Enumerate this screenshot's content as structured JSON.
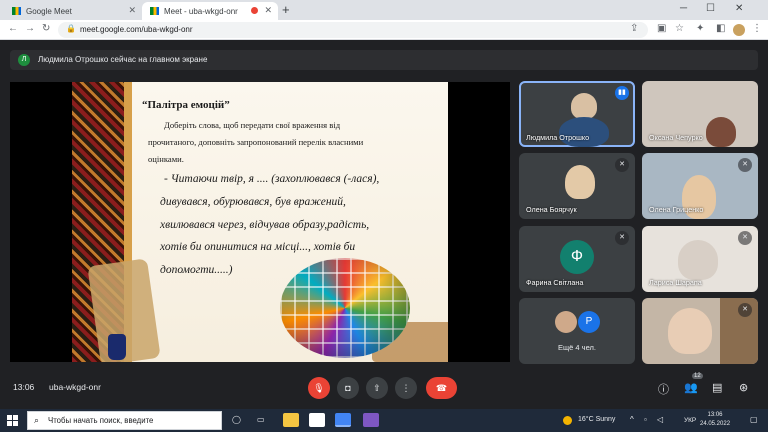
{
  "browser": {
    "tabs": [
      {
        "title": "Google Meet",
        "active": false
      },
      {
        "title": "Meet - uba-wkgd-onr",
        "active": true
      }
    ],
    "url": "meet.google.com/uba-wkgd-onr"
  },
  "meet": {
    "presenting_text": "Людмила Отрошко сейчас на главном экране",
    "presenter_initial": "Л",
    "slide": {
      "title": "“Палітра емоцій”",
      "lines_small": [
        "Доберіть слова, щоб передати свої враження від",
        "прочитаного, доповніть запропонований перелік власними",
        "оцінками."
      ],
      "lines_big": [
        "- Читаючи твір, я ....  (захоплювався (-лася),",
        "дивувався, обурювався, був вражений,",
        "хвилювався через, відчував образу,радість,",
        "хотів би опинитися на місці..., хотів би",
        "допомогти.....)"
      ]
    },
    "participants": [
      {
        "name": "Людмила Отрошко",
        "speaking": true
      },
      {
        "name": "Оксана Чепурко"
      },
      {
        "name": "Олена Боярчук"
      },
      {
        "name": "Олена Гриценко"
      },
      {
        "name": "Фарина Світлана",
        "initial": "Ф"
      },
      {
        "name": "Лариса Шарапа"
      },
      {
        "name": "Ещё 4 чел.",
        "initial": "Р"
      },
      {
        "name": ""
      }
    ],
    "clock": "13:06",
    "meeting_code": "uba-wkgd-onr",
    "people_count": "12"
  },
  "taskbar": {
    "search_placeholder": "Чтобы начать поиск, введите",
    "weather": "16°C  Sunny",
    "lang": "УКР",
    "time": "13:06",
    "date": "24.05.2022"
  },
  "colors": {
    "meet_bg": "#202124",
    "tile_bg": "#3c4043",
    "hangup_red": "#ea4335",
    "speaking_blue": "#8ab4f8"
  }
}
